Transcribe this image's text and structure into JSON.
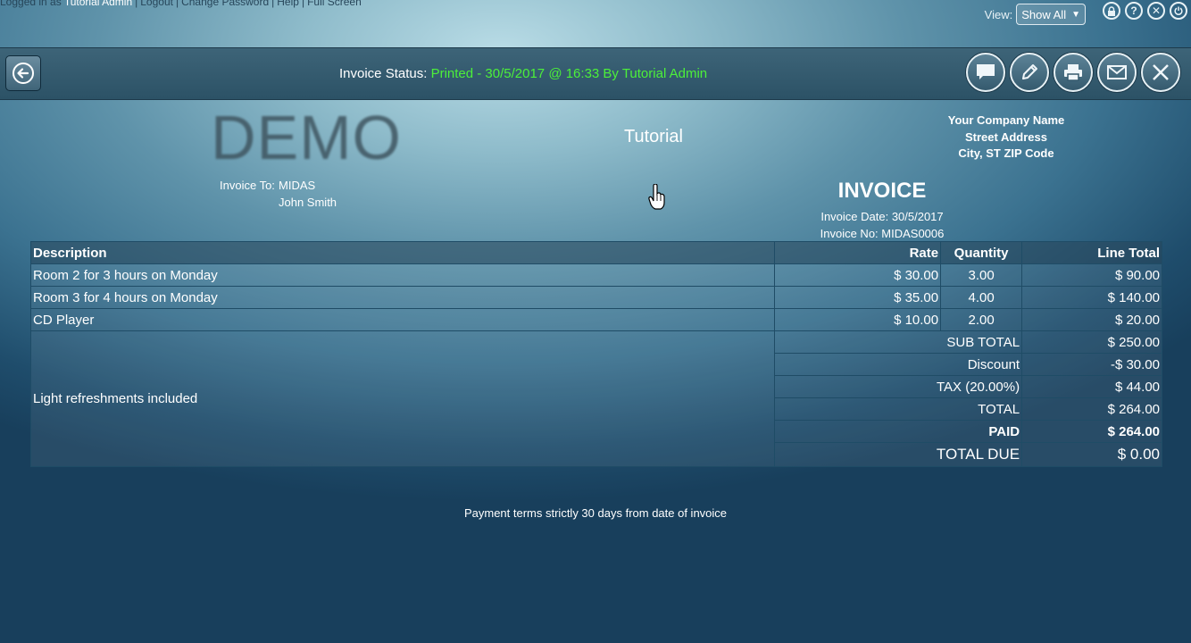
{
  "topbar": {
    "logged_in_prefix": "Logged in as",
    "user": "Tutorial Admin",
    "links": [
      "Logout",
      "Change Password",
      "Help",
      "Full Screen"
    ],
    "view_label": "View:",
    "view_value": "Show All"
  },
  "status": {
    "label": "Invoice Status:",
    "value": "Printed - 30/5/2017 @ 16:33 By Tutorial Admin"
  },
  "header": {
    "logo_text": "DEMO",
    "organization": "Tutorial",
    "company_lines": [
      "Your Company Name",
      "Street Address",
      "City, ST ZIP Code"
    ],
    "invoice_to_label": "Invoice To:",
    "invoice_to_lines": [
      "MIDAS",
      "John Smith"
    ],
    "title": "INVOICE",
    "invoice_date": "Invoice Date: 30/5/2017",
    "invoice_no": "Invoice No: MIDAS0006"
  },
  "table": {
    "headers": [
      "Description",
      "Rate",
      "Quantity",
      "Line Total"
    ],
    "rows": [
      {
        "description": "Room 2 for 3 hours on Monday",
        "rate": "$ 30.00",
        "quantity": "3.00",
        "total": "$ 90.00"
      },
      {
        "description": "Room 3 for 4 hours on Monday",
        "rate": "$ 35.00",
        "quantity": "4.00",
        "total": "$ 140.00"
      },
      {
        "description": "CD Player",
        "rate": "$ 10.00",
        "quantity": "2.00",
        "total": "$ 20.00"
      }
    ],
    "notes": "Light refreshments included",
    "summary": [
      {
        "label": "SUB TOTAL",
        "value": "$ 250.00"
      },
      {
        "label": "Discount",
        "value": "-$ 30.00"
      },
      {
        "label": "TAX (20.00%)",
        "value": "$ 44.00"
      },
      {
        "label": "TOTAL",
        "value": "$ 264.00"
      },
      {
        "label": "PAID",
        "value": "$ 264.00"
      },
      {
        "label": "TOTAL DUE",
        "value": "$ 0.00"
      }
    ]
  },
  "footer": {
    "terms": "Payment terms strictly 30 days from date of invoice"
  },
  "icons": {
    "top": [
      "lock-icon",
      "help-icon",
      "close-icon",
      "power-icon"
    ],
    "actions": [
      "comment-icon",
      "edit-icon",
      "print-icon",
      "email-icon",
      "close-icon"
    ]
  }
}
